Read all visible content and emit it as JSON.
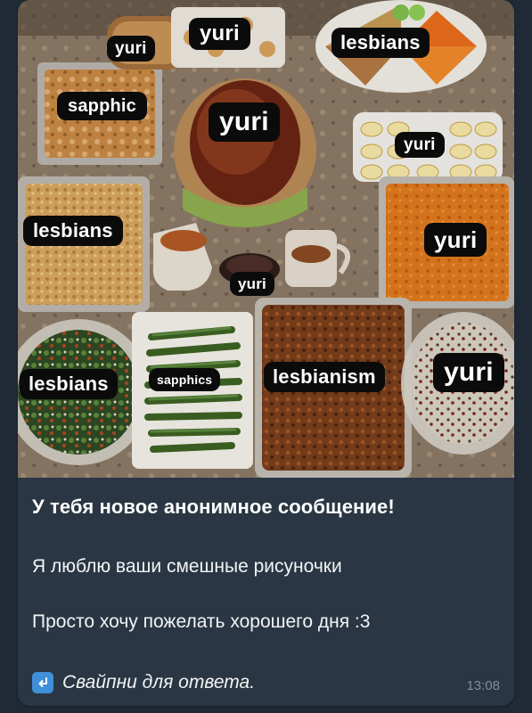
{
  "photo": {
    "labels": [
      {
        "text": "yuri"
      },
      {
        "text": "yuri"
      },
      {
        "text": "lesbians"
      },
      {
        "text": "sapphic"
      },
      {
        "text": "yuri"
      },
      {
        "text": "yuri"
      },
      {
        "text": "lesbians"
      },
      {
        "text": "yuri"
      },
      {
        "text": "yuri"
      },
      {
        "text": "lesbians"
      },
      {
        "text": "sapphics"
      },
      {
        "text": "lesbianism"
      },
      {
        "text": "yuri"
      }
    ]
  },
  "message": {
    "heading": "У тебя новое анонимное сообщение!",
    "line1": "Я люблю ваши смешные рисуночки",
    "line2": "Просто хочу пожелать хорошего дня :3",
    "reply_prompt": "Свайпни для ответа.",
    "time": "13:08"
  },
  "colors": {
    "chat_background": "#1f2a36",
    "bubble": "#2a3643",
    "reply_icon": "#3f8fd9",
    "timestamp": "#7f8d9a"
  },
  "icons": {
    "reply": "return-arrow-icon"
  }
}
